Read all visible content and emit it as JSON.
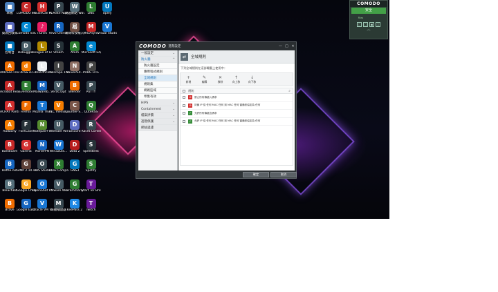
{
  "desktop": {
    "icons": [
      {
        "label": "本機",
        "color": "#4a7fbf",
        "glyph": "■",
        "col": 0,
        "row": 0
      },
      {
        "label": "COMODO Firewall",
        "color": "#c62828",
        "glyph": "C",
        "col": 1,
        "row": 0
      },
      {
        "label": "HouseCall for Home",
        "color": "#d32f2f",
        "glyph": "H",
        "col": 2,
        "row": 0
      },
      {
        "label": "PCMate Novva",
        "color": "#37474f",
        "glyph": "P",
        "col": 3,
        "row": 0
      },
      {
        "label": "跳過網站 WaveEdit",
        "color": "#546e7a",
        "glyph": "W",
        "col": 4,
        "row": 0
      },
      {
        "label": "LINE",
        "color": "#2e7d32",
        "glyph": "L",
        "col": 5,
        "row": 0
      },
      {
        "label": "Upley",
        "color": "#0277bd",
        "glyph": "U",
        "col": 6,
        "row": 0
      },
      {
        "label": "資源回收筒",
        "color": "#5c6bc0",
        "glyph": "■",
        "col": 0,
        "row": 1
      },
      {
        "label": "Comodo IceDragon",
        "color": "#0288d1",
        "glyph": "C",
        "col": 1,
        "row": 1
      },
      {
        "label": "iTunes",
        "color": "#e91e63",
        "glyph": "♪",
        "col": 2,
        "row": 1
      },
      {
        "label": "Revo Uninstaller",
        "color": "#1565c0",
        "glyph": "R",
        "col": 3,
        "row": 1
      },
      {
        "label": "易博科技輸入法 12",
        "color": "#6d4c41",
        "glyph": "易",
        "col": 4,
        "row": 1
      },
      {
        "label": "MIGAsync",
        "color": "#c62828",
        "glyph": "M",
        "col": 5,
        "row": 1
      },
      {
        "label": "Visual Studio Code",
        "color": "#1976d2",
        "glyph": "V",
        "col": 6,
        "row": 1
      },
      {
        "label": "控制台",
        "color": "#0277bd",
        "glyph": "■",
        "col": 0,
        "row": 2
      },
      {
        "label": "Debuggler",
        "color": "#455a64",
        "glyph": "D",
        "col": 1,
        "row": 2
      },
      {
        "label": "League of Legends",
        "color": "#b28900",
        "glyph": "L",
        "col": 2,
        "row": 2
      },
      {
        "label": "Steam",
        "color": "#263238",
        "glyph": "S",
        "col": 3,
        "row": 2
      },
      {
        "label": "Atom",
        "color": "#2e7d32",
        "glyph": "A",
        "col": 4,
        "row": 2
      },
      {
        "label": "Microsoft Edge",
        "color": "#0288d1",
        "glyph": "e",
        "col": 5,
        "row": 2
      },
      {
        "label": "AKDSee Free",
        "color": "#ef6c00",
        "glyph": "A",
        "col": 0,
        "row": 3
      },
      {
        "label": "draw.io",
        "color": "#f57c00",
        "glyph": "d",
        "col": 1,
        "row": 3
      },
      {
        "label": "LibreOffice 6.4",
        "color": "#eceff1",
        "glyph": "L",
        "col": 2,
        "row": 3
      },
      {
        "label": "Inkscape 1.0",
        "color": "#424242",
        "glyph": "I",
        "col": 3,
        "row": 3
      },
      {
        "label": "NaivePEd...",
        "color": "#8d6e63",
        "glyph": "N",
        "col": 4,
        "row": 3
      },
      {
        "label": "PUBG LITE",
        "color": "#424242",
        "glyph": "P",
        "col": 5,
        "row": 3
      },
      {
        "label": "Acrobat Reader DC",
        "color": "#c62828",
        "glyph": "A",
        "col": 0,
        "row": 4
      },
      {
        "label": "Evernote",
        "color": "#2e7d32",
        "glyph": "E",
        "col": 1,
        "row": 4
      },
      {
        "label": "Malwareb...",
        "color": "#1565c0",
        "glyph": "M",
        "col": 2,
        "row": 4
      },
      {
        "label": "VeraCrypt",
        "color": "#455a64",
        "glyph": "V",
        "col": 3,
        "row": 4
      },
      {
        "label": "Blender",
        "color": "#ef6c00",
        "glyph": "B",
        "col": 4,
        "row": 4
      },
      {
        "label": "PuTTY",
        "color": "#37474f",
        "glyph": "P",
        "col": 5,
        "row": 4
      },
      {
        "label": "ACHAT Pantium...",
        "color": "#d32f2f",
        "glyph": "A",
        "col": 0,
        "row": 5
      },
      {
        "label": "Firefox",
        "color": "#ef6c00",
        "glyph": "F",
        "col": 1,
        "row": 5
      },
      {
        "label": "Mozilla Thunderbird",
        "color": "#1976d2",
        "glyph": "T",
        "col": 2,
        "row": 5
      },
      {
        "label": "VLC media player",
        "color": "#f57c00",
        "glyph": "V",
        "col": 3,
        "row": 5
      },
      {
        "label": "Counter-S... Global Off...",
        "color": "#795548",
        "glyph": "C",
        "col": 4,
        "row": 5
      },
      {
        "label": "QuteRSS",
        "color": "#2e7d32",
        "glyph": "Q",
        "col": 5,
        "row": 5
      },
      {
        "label": "Audacity",
        "color": "#f57c00",
        "glyph": "A",
        "col": 0,
        "row": 6
      },
      {
        "label": "FontCase",
        "color": "#263238",
        "glyph": "F",
        "col": 1,
        "row": 6
      },
      {
        "label": "Notepad++",
        "color": "#558b2f",
        "glyph": "N",
        "col": 2,
        "row": 6
      },
      {
        "label": "Ultimate Windows Tweaker",
        "color": "#455a64",
        "glyph": "U",
        "col": 3,
        "row": 6
      },
      {
        "label": "Discord",
        "color": "#5c6bc0",
        "glyph": "D",
        "col": 4,
        "row": 6
      },
      {
        "label": "Racet Cortex",
        "color": "#37474f",
        "glyph": "R",
        "col": 5,
        "row": 6
      },
      {
        "label": "Bandicam",
        "color": "#c62828",
        "glyph": "B",
        "col": 0,
        "row": 7
      },
      {
        "label": "Garena",
        "color": "#d32f2f",
        "glyph": "G",
        "col": 1,
        "row": 7
      },
      {
        "label": "NordVPN",
        "color": "#1565c0",
        "glyph": "N",
        "col": 2,
        "row": 7
      },
      {
        "label": "Win32Dis...",
        "color": "#1976d2",
        "glyph": "W",
        "col": 3,
        "row": 7
      },
      {
        "label": "Dota 2",
        "color": "#b71c1c",
        "glyph": "D",
        "col": 4,
        "row": 7
      },
      {
        "label": "Speedtest",
        "color": "#263238",
        "glyph": "S",
        "col": 5,
        "row": 7
      },
      {
        "label": "Battle.net",
        "color": "#1565c0",
        "glyph": "B",
        "col": 0,
        "row": 8
      },
      {
        "label": "GIMP 2.10.18",
        "color": "#5d4037",
        "glyph": "G",
        "col": 1,
        "row": 8
      },
      {
        "label": "OBS Studio",
        "color": "#37474f",
        "glyph": "O",
        "col": 2,
        "row": 8
      },
      {
        "label": "Xbox Companion",
        "color": "#2e7d32",
        "glyph": "X",
        "col": 3,
        "row": 8
      },
      {
        "label": "GNS3",
        "color": "#0277bd",
        "glyph": "G",
        "col": 4,
        "row": 8
      },
      {
        "label": "Spotify",
        "color": "#2e7d32",
        "glyph": "S",
        "col": 5,
        "row": 8
      },
      {
        "label": "BleachBit",
        "color": "#546e7a",
        "glyph": "B",
        "col": 0,
        "row": 9
      },
      {
        "label": "Google Chrome",
        "color": "#f9a825",
        "glyph": "G",
        "col": 1,
        "row": 9
      },
      {
        "label": "OpenShot Video Editor",
        "color": "#1976d2",
        "glyph": "O",
        "col": 2,
        "row": 9
      },
      {
        "label": "VMware Workstati...",
        "color": "#455a64",
        "glyph": "V",
        "col": 3,
        "row": 9
      },
      {
        "label": "Grammarly",
        "color": "#2e7d32",
        "glyph": "G",
        "col": 4,
        "row": 9
      },
      {
        "label": "Start Tor Browser",
        "color": "#6a1b9a",
        "glyph": "T",
        "col": 5,
        "row": 9
      },
      {
        "label": "Brave",
        "color": "#ef6c00",
        "glyph": "B",
        "col": 0,
        "row": 10
      },
      {
        "label": "Google Earth Pro",
        "color": "#1565c0",
        "glyph": "G",
        "col": 1,
        "row": 10
      },
      {
        "label": "Oracle VM VirtualBox",
        "color": "#1976d2",
        "glyph": "V",
        "col": 2,
        "row": 10
      },
      {
        "label": "媒體播放器",
        "color": "#37474f",
        "glyph": "M",
        "col": 3,
        "row": 10
      },
      {
        "label": "KeePass 2",
        "color": "#1e88e5",
        "glyph": "K",
        "col": 4,
        "row": 10
      },
      {
        "label": "Twitch",
        "color": "#6a1b9a",
        "glyph": "T",
        "col": 5,
        "row": 10
      }
    ]
  },
  "widget": {
    "logo": "COMODO",
    "status": "安全",
    "stat_left_label": "Files",
    "stat_left_value": "",
    "stat_right_label": "",
    "stat_right_value": "",
    "tools": [
      "□",
      "□",
      "▣",
      "□"
    ],
    "chevron": "︿"
  },
  "dialog": {
    "logo": "COMODO",
    "subtitle": "進階設定",
    "win_buttons": [
      "—",
      "□",
      "✕"
    ],
    "sidebar": [
      {
        "label": "一般設定",
        "type": "section",
        "chev": "⌄"
      },
      {
        "label": "防火牆",
        "type": "section",
        "active": true,
        "chev": "^"
      },
      {
        "label": "防火牆設定",
        "type": "sub"
      },
      {
        "label": "應用程式規則",
        "type": "sub"
      },
      {
        "label": "全域規則",
        "type": "sub",
        "selected": true
      },
      {
        "label": "規則集",
        "type": "sub"
      },
      {
        "label": "網路區域",
        "type": "sub"
      },
      {
        "label": "埠集有效",
        "type": "sub"
      },
      {
        "label": "HIPS",
        "type": "section",
        "chev": "⌄"
      },
      {
        "label": "Containment",
        "type": "section",
        "chev": "⌄"
      },
      {
        "label": "檔案評價",
        "type": "section",
        "chev": "⌄"
      },
      {
        "label": "進階保護",
        "type": "section",
        "chev": "⌄"
      },
      {
        "label": "網站過濾",
        "type": "section"
      }
    ],
    "header_title": "全域規則",
    "description": "下列全域規則在這部電腦上使用中：",
    "toolbar": [
      {
        "icon": "+",
        "label": "新增"
      },
      {
        "icon": "✎",
        "label": "編輯"
      },
      {
        "icon": "✕",
        "label": "移除"
      },
      {
        "icon": "↑",
        "label": "向上移"
      },
      {
        "icon": "↓",
        "label": "向下移"
      }
    ],
    "table_header": "規則",
    "search_icon": "⌕",
    "rules": [
      {
        "label": "禁止所有傳遞入請求",
        "status": "block"
      },
      {
        "label": "封鎖 IP 從 任何 MAC 任何 到 MAC 任何 當通訊協定為 任何",
        "status": "block"
      },
      {
        "label": "允許所有傳遞出請求",
        "status": "allow"
      },
      {
        "label": "允許 IP 從 任何 MAC 任何 到 MAC 任何 當通訊協定為 任何",
        "status": "allow"
      }
    ],
    "ok_label": "確定",
    "cancel_label": "取消"
  }
}
